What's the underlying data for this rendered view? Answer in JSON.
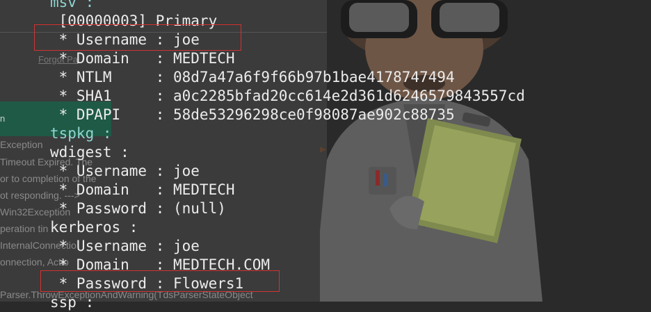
{
  "background_page": {
    "forgot_link": "Forgot Pa",
    "button_label": "n",
    "error_lines": [
      "Exception",
      "Timeout Expired. The",
      "or to completion of the",
      "ot responding. --->",
      "Win32Exception",
      "peration tin",
      "InternalConnectio",
      "onnection, Actio",
      "Parser.ThrowExceptionAndWarning(TdsParserStateObject"
    ]
  },
  "terminal": {
    "lines": [
      "msv :",
      " [00000003] Primary",
      " * Username : joe",
      " * Domain   : MEDTECH",
      " * NTLM     : 08d7a47a6f9f66b97b1bae4178747494",
      " * SHA1     : a0c2285bfad20cc614e2d361d6246579843557cd",
      " * DPAPI    : 58de53296298ce0f98087ae902c88735",
      "tspkg :",
      "wdigest :",
      " * Username : joe",
      " * Domain   : MEDTECH",
      " * Password : (null)",
      "kerberos :",
      " * Username : joe",
      " * Domain   : MEDTECH.COM",
      " * Password : Flowers1",
      "ssp :"
    ]
  },
  "colors": {
    "terminal_text": "#ececec",
    "section_label": "#8fd6d0",
    "highlight_box": "#d23232",
    "button_green": "#1f5a46"
  }
}
